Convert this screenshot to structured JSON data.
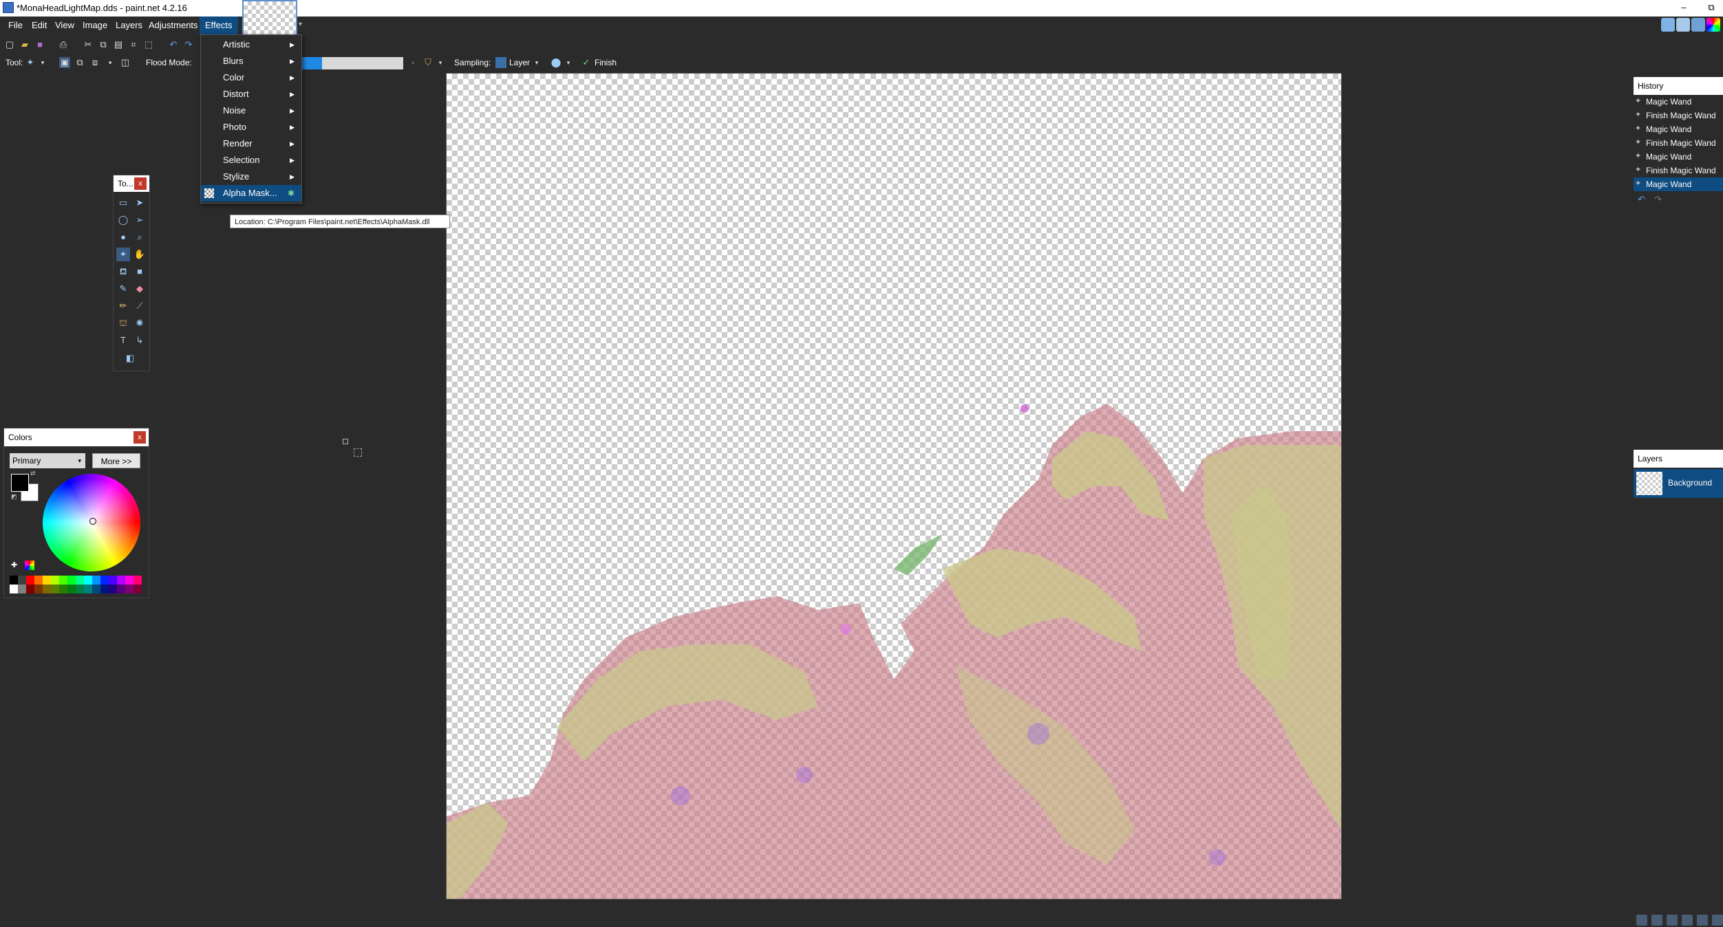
{
  "window": {
    "title": "*MonaHeadLightMap.dds - paint.net 4.2.16",
    "minimize": "–",
    "restore": "⧉"
  },
  "menubar": {
    "items": [
      "File",
      "Edit",
      "View",
      "Image",
      "Layers",
      "Adjustments",
      "Effects"
    ],
    "active": "Effects"
  },
  "toolbar": {
    "tool_label": "Tool:",
    "flood_mode_label": "Flood Mode:",
    "tolerance_value": 0.2,
    "sampling_label": "Sampling:",
    "sampling_value": "Layer",
    "finish_label": "Finish"
  },
  "effects_menu": {
    "items": [
      {
        "label": "Artistic",
        "submenu": true
      },
      {
        "label": "Blurs",
        "submenu": true
      },
      {
        "label": "Color",
        "submenu": true
      },
      {
        "label": "Distort",
        "submenu": true
      },
      {
        "label": "Noise",
        "submenu": true
      },
      {
        "label": "Photo",
        "submenu": true
      },
      {
        "label": "Render",
        "submenu": true
      },
      {
        "label": "Selection",
        "submenu": true
      },
      {
        "label": "Stylize",
        "submenu": true
      },
      {
        "label": "Alpha Mask...",
        "submenu": false,
        "selected": true
      }
    ],
    "submenu_arrow": "▶",
    "tooltip": "Location: C:\\Program Files\\paint.net\\Effects\\AlphaMask.dll"
  },
  "tools_window": {
    "title": "To...",
    "close": "x"
  },
  "colors_window": {
    "title": "Colors",
    "close": "x",
    "mode_value": "Primary",
    "more_button": "More >>",
    "primary_color": "#000000",
    "secondary_color": "#ffffff"
  },
  "history": {
    "title": "History",
    "items": [
      "Magic Wand",
      "Finish Magic Wand",
      "Magic Wand",
      "Finish Magic Wand",
      "Magic Wand",
      "Finish Magic Wand",
      "Magic Wand"
    ],
    "selected_index": 6,
    "undo_icon": "↶",
    "redo_icon": "↷"
  },
  "layers": {
    "title": "Layers",
    "items": [
      {
        "name": "Background",
        "selected": true
      }
    ]
  },
  "colors": {
    "accent": "#0f4c81",
    "selection_pink": "#d48a91",
    "selection_yellow": "#c9c98a",
    "background": "#2b2b2b"
  }
}
